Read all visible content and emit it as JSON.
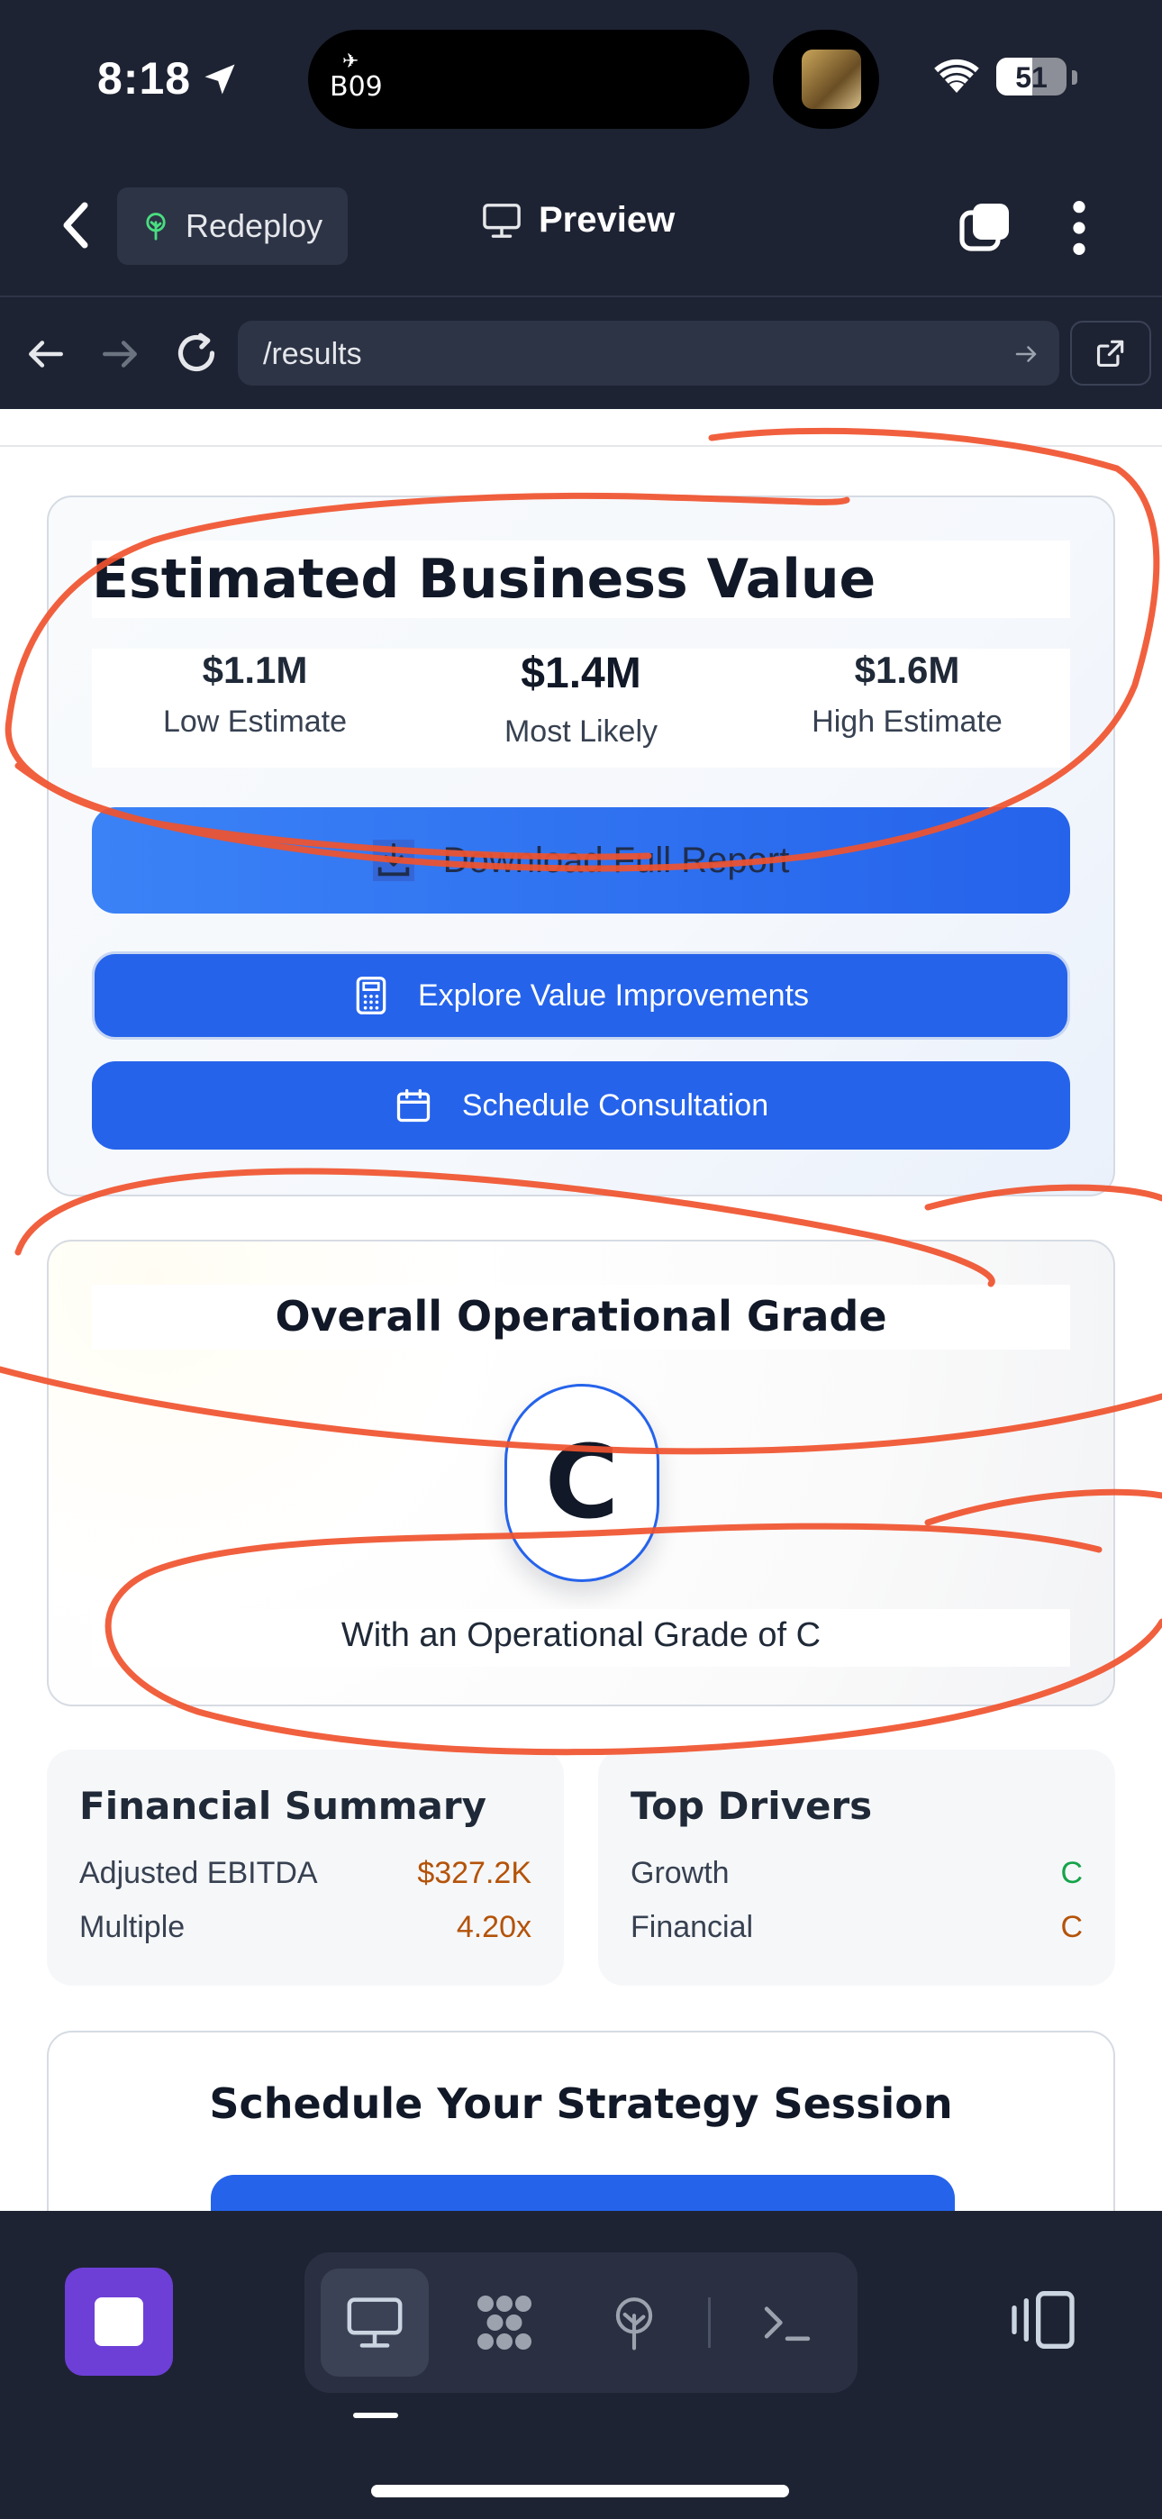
{
  "status_bar": {
    "time": "8:18",
    "island_text": "B09",
    "battery_level": "51",
    "battery_fraction": 0.51
  },
  "header": {
    "redeploy_label": "Redeploy",
    "preview_label": "Preview"
  },
  "url_bar": {
    "url": "/results"
  },
  "value_card": {
    "title": "Estimated Business Value",
    "estimates": [
      {
        "value": "$1.1M",
        "label": "Low Estimate"
      },
      {
        "value": "$1.4M",
        "label": "Most Likely"
      },
      {
        "value": "$1.6M",
        "label": "High Estimate"
      }
    ],
    "download_label": "Download Full Report",
    "explore_label": "Explore Value Improvements",
    "schedule_label": "Schedule Consultation"
  },
  "grade_card": {
    "title": "Overall Operational Grade",
    "grade": "C",
    "subtitle": "With an Operational Grade of C"
  },
  "financial_summary": {
    "title": "Financial Summary",
    "rows": [
      {
        "label": "Adjusted EBITDA",
        "value": "$327.2K"
      },
      {
        "label": "Multiple",
        "value": "4.20x"
      }
    ]
  },
  "top_drivers": {
    "title": "Top Drivers",
    "rows": [
      {
        "label": "Growth",
        "value": "C"
      },
      {
        "label": "Financial",
        "value": "C"
      }
    ]
  },
  "strategy_card": {
    "title": "Schedule Your Strategy Session"
  },
  "colors": {
    "accent_blue": "#2563eb",
    "stop_purple": "#6d3fd6",
    "scribble_red": "#f0532e",
    "value_orange": "#b45309",
    "value_green": "#16a34a",
    "chrome_dark": "#1e2333"
  },
  "icons": {
    "location": "location-arrow-icon",
    "wifi": "wifi-icon",
    "back": "chevron-left-icon",
    "redeploy": "tree-icon",
    "preview": "monitor-icon",
    "tabs": "tabs-icon",
    "more": "vertical-dots-icon",
    "reload": "reload-icon",
    "download": "download-icon",
    "calculator": "calculator-icon",
    "calendar": "calendar-icon",
    "terminal": "terminal-icon",
    "device": "device-toggle-icon"
  }
}
